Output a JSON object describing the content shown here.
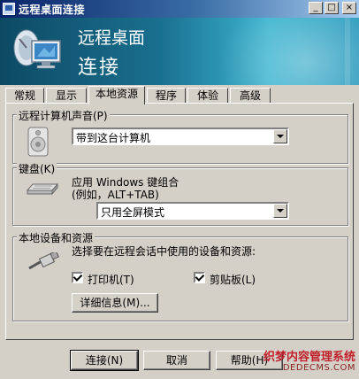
{
  "window": {
    "title": "远程桌面连接"
  },
  "titlebar_buttons": {
    "minimize": "_",
    "maximize": "□",
    "close": "×"
  },
  "banner": {
    "line1": "远程桌面",
    "line2": "连接"
  },
  "tabs": [
    {
      "label": "常规"
    },
    {
      "label": "显示"
    },
    {
      "label": "本地资源"
    },
    {
      "label": "程序"
    },
    {
      "label": "体验"
    },
    {
      "label": "高级"
    }
  ],
  "sound": {
    "group_title": "远程计算机声音(P)",
    "selected": "带到这台计算机"
  },
  "keyboard": {
    "group_title": "键盘(K)",
    "line1": "应用 Windows 键组合",
    "line2": "(例如，ALT+TAB)",
    "selected": "只用全屏模式"
  },
  "devices": {
    "group_title": "本地设备和资源",
    "description": "选择要在远程会话中使用的设备和资源:",
    "printer": {
      "label": "打印机(T)",
      "checked": true
    },
    "clipboard": {
      "label": "剪贴板(L)",
      "checked": true
    },
    "details_button": "详细信息(M)..."
  },
  "footer": {
    "connect": "连接(N)",
    "cancel": "取消",
    "help": "帮助(H)"
  },
  "watermark": {
    "line1": "织梦内容管理系统",
    "line2": "DEDECMS.COM"
  }
}
